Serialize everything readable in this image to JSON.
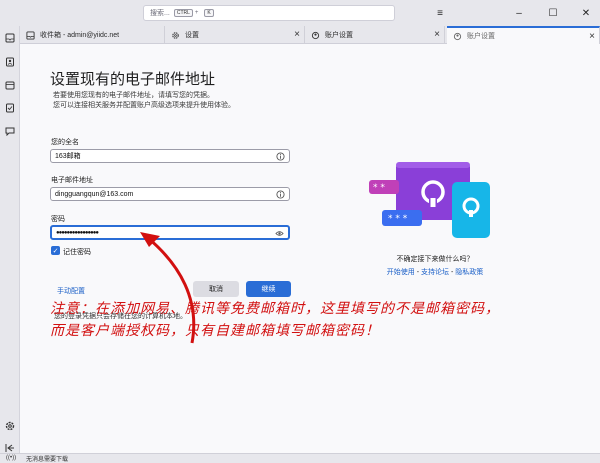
{
  "titlebar": {
    "search_placeholder": "搜索...",
    "shortcut_ctrl": "CTRL",
    "shortcut_key": "K"
  },
  "tabs": [
    {
      "label": "收件箱 - admin@yiidc.net",
      "icon": "inbox-icon"
    },
    {
      "label": "设置",
      "icon": "gear-icon"
    },
    {
      "label": "账户设置",
      "icon": "account-settings-icon"
    },
    {
      "label": "账户设置",
      "icon": "account-settings-icon"
    }
  ],
  "form": {
    "title": "设置现有的电子邮件地址",
    "subtitle_line1": "若要使用您现有的电子邮件地址，请填写您的凭据。",
    "subtitle_line2": "您可以连接相关服务并配置账户高级选项来提升使用体验。",
    "name_label": "您的全名",
    "name_value": "163邮箱",
    "email_label": "电子邮件地址",
    "email_value": "dingguangqun@163.com",
    "password_label": "密码",
    "password_value": "●●●●●●●●●●●●●●●●",
    "remember_label": "记住密码",
    "manual_config": "手动配置",
    "cancel_label": "取消",
    "continue_label": "继续",
    "storage_note": "您的登录凭据只会存储在您的计算机本地。"
  },
  "help": {
    "question": "不确定接下来做什么吗？",
    "link_start": "开始使用",
    "link_forum": "支持论坛",
    "link_privacy": "隐私政策",
    "separator": " - "
  },
  "annotation": {
    "line1": "注意：在添加网易、腾讯等免费邮箱时，这里填写的不是邮箱密码，",
    "line2": "而是客户端授权码，只有自建邮箱填写邮箱密码！"
  },
  "statusbar": {
    "text": "无消息需要下载"
  },
  "colors": {
    "accent": "#2a6dd6",
    "annotation": "#d21010",
    "illustration_purple": "#8a3fd8",
    "illustration_cyan": "#17b6e8"
  }
}
